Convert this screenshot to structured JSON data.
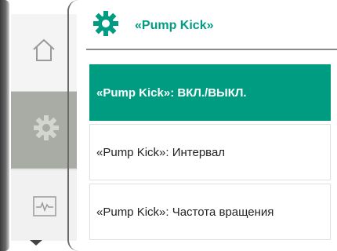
{
  "header": {
    "title": "«Pump Kick»",
    "icon": "gear-icon"
  },
  "menu": {
    "items": [
      {
        "label": "«Pump Kick»: ВКЛ./ВЫКЛ.",
        "selected": true
      },
      {
        "label": "«Pump Kick»: Интервал",
        "selected": false
      },
      {
        "label": "«Pump Kick»: Частота вращения",
        "selected": false
      }
    ]
  },
  "rail": {
    "items": [
      {
        "name": "home",
        "icon": "home-icon"
      },
      {
        "name": "settings",
        "icon": "gear-icon",
        "active": true
      },
      {
        "name": "status",
        "icon": "pulse-icon"
      }
    ],
    "scroll": "chevron-down-icon"
  },
  "colors": {
    "accent": "#009c82",
    "rail_active": "#a9aca4",
    "text": "#222222"
  }
}
